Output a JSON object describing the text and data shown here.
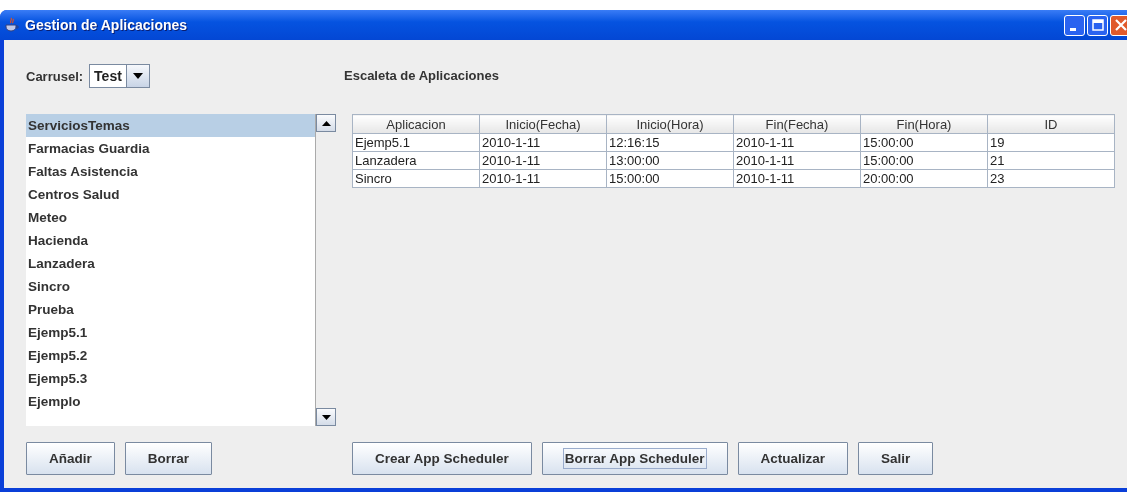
{
  "window": {
    "title": "Gestion de Aplicaciones"
  },
  "carrusel": {
    "label": "Carrusel:",
    "value": "Test"
  },
  "applications": [
    {
      "label": "ServiciosTemas",
      "selected": true
    },
    {
      "label": "Farmacias Guardia",
      "selected": false
    },
    {
      "label": "Faltas Asistencia",
      "selected": false
    },
    {
      "label": "Centros Salud",
      "selected": false
    },
    {
      "label": "Meteo",
      "selected": false
    },
    {
      "label": "Hacienda",
      "selected": false
    },
    {
      "label": "Lanzadera",
      "selected": false
    },
    {
      "label": "Sincro",
      "selected": false
    },
    {
      "label": "Prueba",
      "selected": false
    },
    {
      "label": "Ejemp5.1",
      "selected": false
    },
    {
      "label": "Ejemp5.2",
      "selected": false
    },
    {
      "label": "Ejemp5.3",
      "selected": false
    },
    {
      "label": "Ejemplo",
      "selected": false
    }
  ],
  "left_buttons": [
    {
      "label": "Añadir",
      "focused": false
    },
    {
      "label": "Borrar",
      "focused": false
    }
  ],
  "schedule": {
    "title": "Escaleta de Aplicaciones",
    "columns": [
      "Aplicacion",
      "Inicio(Fecha)",
      "Inicio(Hora)",
      "Fin(Fecha)",
      "Fin(Hora)",
      "ID"
    ],
    "rows": [
      [
        "Ejemp5.1",
        "2010-1-11",
        "12:16:15",
        "2010-1-11",
        "15:00:00",
        "19"
      ],
      [
        "Lanzadera",
        "2010-1-11",
        "13:00:00",
        "2010-1-11",
        "15:00:00",
        "21"
      ],
      [
        "Sincro",
        "2010-1-11",
        "15:00:00",
        "2010-1-11",
        "20:00:00",
        "23"
      ]
    ]
  },
  "right_buttons": [
    {
      "label": "Crear App Scheduler",
      "focused": false
    },
    {
      "label": "Borrar App Scheduler",
      "focused": true
    },
    {
      "label": "Actualizar",
      "focused": false
    },
    {
      "label": "Salir",
      "focused": false
    }
  ]
}
